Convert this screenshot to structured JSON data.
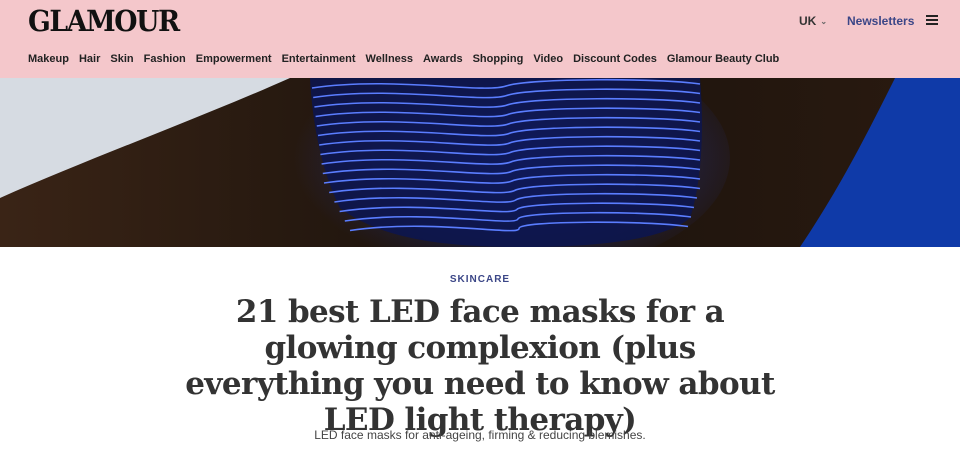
{
  "header": {
    "logo": "GLAMOUR",
    "region": "UK",
    "newsletters": "Newsletters",
    "menu_icon": "hamburger-menu-icon",
    "background_color": "#f4c7cb"
  },
  "nav": {
    "items": [
      "Makeup",
      "Hair",
      "Skin",
      "Fashion",
      "Empowerment",
      "Entertainment",
      "Wellness",
      "Awards",
      "Shopping",
      "Video",
      "Discount Codes",
      "Glamour Beauty Club"
    ]
  },
  "hero": {
    "description": "blue-led-face-mask-image",
    "accent_color": "#1f3fbf"
  },
  "article": {
    "section": "SKINCARE",
    "headline": "21 best LED face masks for a glowing complexion (plus everything you need to know about LED light therapy)",
    "dek": "LED face masks for anti-ageing, firming & reducing blemishes.",
    "section_color": "#3b4687"
  }
}
